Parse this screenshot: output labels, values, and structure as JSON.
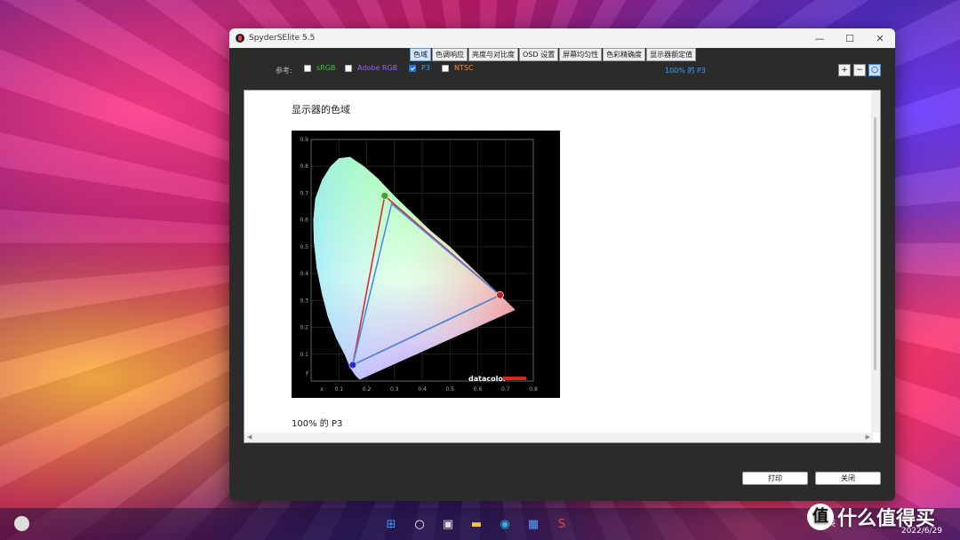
{
  "window": {
    "title": "SpyderSElite 5.5",
    "controls": {
      "minimize": "—",
      "maximize": "☐",
      "close": "✕"
    }
  },
  "tabs": [
    {
      "label": "色域",
      "active": true
    },
    {
      "label": "色调响应",
      "active": false
    },
    {
      "label": "亮度与对比度",
      "active": false
    },
    {
      "label": "OSD 设置",
      "active": false
    },
    {
      "label": "屏幕均匀性",
      "active": false
    },
    {
      "label": "色彩精确度",
      "active": false
    },
    {
      "label": "显示器额定值",
      "active": false
    }
  ],
  "reference": {
    "label": "参考:",
    "options": [
      {
        "label": "sRGB",
        "checked": false,
        "color": "#39c639"
      },
      {
        "label": "Adobe RGB",
        "checked": false,
        "color": "#9a5cff"
      },
      {
        "label": "P3",
        "checked": true,
        "color": "#3b9cff"
      },
      {
        "label": "NTSC",
        "checked": false,
        "color": "#ff8a2a"
      }
    ],
    "summary": "100% 的 P3"
  },
  "zoom": {
    "zoom_in": "+",
    "zoom_out": "−",
    "fit": "○"
  },
  "report": {
    "heading": "显示器的色域",
    "caption": "100% 的 P3"
  },
  "chart_data": {
    "type": "scatter",
    "xlabel": "x",
    "ylabel": "y",
    "xlim": [
      0,
      0.8
    ],
    "ylim": [
      0,
      0.9
    ],
    "xticks": [
      "x",
      "0.1",
      "0.2",
      "0.3",
      "0.4",
      "0.5",
      "0.6",
      "0.7",
      "0.8"
    ],
    "yticks": [
      "y",
      "0.1",
      "0.2",
      "0.3",
      "0.4",
      "0.5",
      "0.6",
      "0.7",
      "0.8",
      "0.9"
    ],
    "watermark": "datacolor",
    "triangles": [
      {
        "color": "#d23030",
        "points": [
          [
            0.68,
            0.32
          ],
          [
            0.265,
            0.69
          ],
          [
            0.15,
            0.06
          ]
        ]
      },
      {
        "color": "#4b8be0",
        "points": [
          [
            0.68,
            0.32
          ],
          [
            0.29,
            0.66
          ],
          [
            0.15,
            0.06
          ]
        ]
      }
    ],
    "primaries": [
      {
        "color": "#c41e1e",
        "x": 0.68,
        "y": 0.32
      },
      {
        "color": "#3aa832",
        "x": 0.265,
        "y": 0.69
      },
      {
        "color": "#2a2ad8",
        "x": 0.15,
        "y": 0.06
      }
    ]
  },
  "buttons": {
    "print": "打印",
    "close": "关闭"
  },
  "taskbar": {
    "icons": [
      {
        "name": "start",
        "glyph": "⊞",
        "color": "#3b9cff"
      },
      {
        "name": "search",
        "glyph": "○",
        "color": "#ffffff"
      },
      {
        "name": "taskview",
        "glyph": "▣",
        "color": "#dddddd"
      },
      {
        "name": "explorer",
        "glyph": "▬",
        "color": "#f5c243"
      },
      {
        "name": "edge",
        "glyph": "◉",
        "color": "#2fb3e8"
      },
      {
        "name": "store",
        "glyph": "▦",
        "color": "#4aa3ff"
      },
      {
        "name": "spyder",
        "glyph": "S",
        "color": "#e84040"
      }
    ],
    "ime": "英",
    "date": "2022/6/29"
  },
  "watermark_site": {
    "badge": "值",
    "text": "什么值得买"
  }
}
